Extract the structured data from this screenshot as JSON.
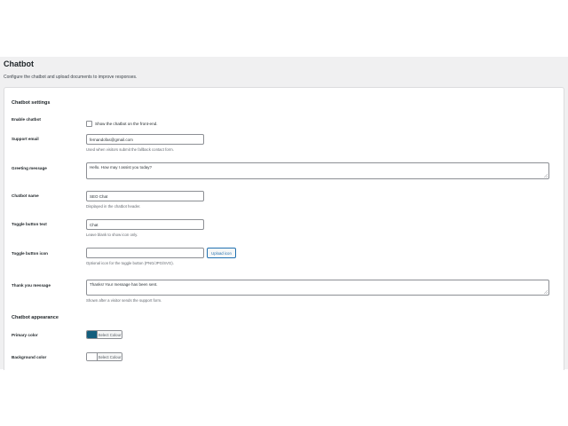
{
  "page": {
    "title": "Chatbot",
    "description": "Configure the chatbot and upload documents to improve responses."
  },
  "settings": {
    "section_title": "Chatbot settings",
    "enable": {
      "label": "Enable chatbot",
      "checkbox_label": "Show the chatbot on the front-end.",
      "checked": false
    },
    "support_email": {
      "label": "Support email",
      "value": "fernandofas@gmail.com",
      "hint": "Used when visitors submit the fallback contact form."
    },
    "greeting": {
      "label": "Greeting message",
      "value": "Hello. How may I assist you today?"
    },
    "name": {
      "label": "Chatbot name",
      "value": "SEO Chat",
      "hint": "Displayed in the chatbot header."
    },
    "toggle_text": {
      "label": "Toggle button text",
      "value": "Chat",
      "hint": "Leave blank to show icon only."
    },
    "toggle_icon": {
      "label": "Toggle button icon",
      "value": "",
      "upload_label": "Upload icon",
      "hint": "Optional icon for the toggle button (PNG/JPG/SVG)."
    },
    "thank_you": {
      "label": "Thank you message",
      "value": "Thanks! Your message has been sent.",
      "hint": "Shown after a visitor sends the support form."
    }
  },
  "appearance": {
    "section_title": "Chatbot appearance",
    "primary": {
      "label": "Primary color",
      "button_label": "Select Colour",
      "color": "#135e7d"
    },
    "background": {
      "label": "Background color",
      "button_label": "Select Colour",
      "color": "#ffffff"
    }
  },
  "colors": {
    "admin_bg": "#f0f0f1",
    "accent": "#2271b1"
  }
}
